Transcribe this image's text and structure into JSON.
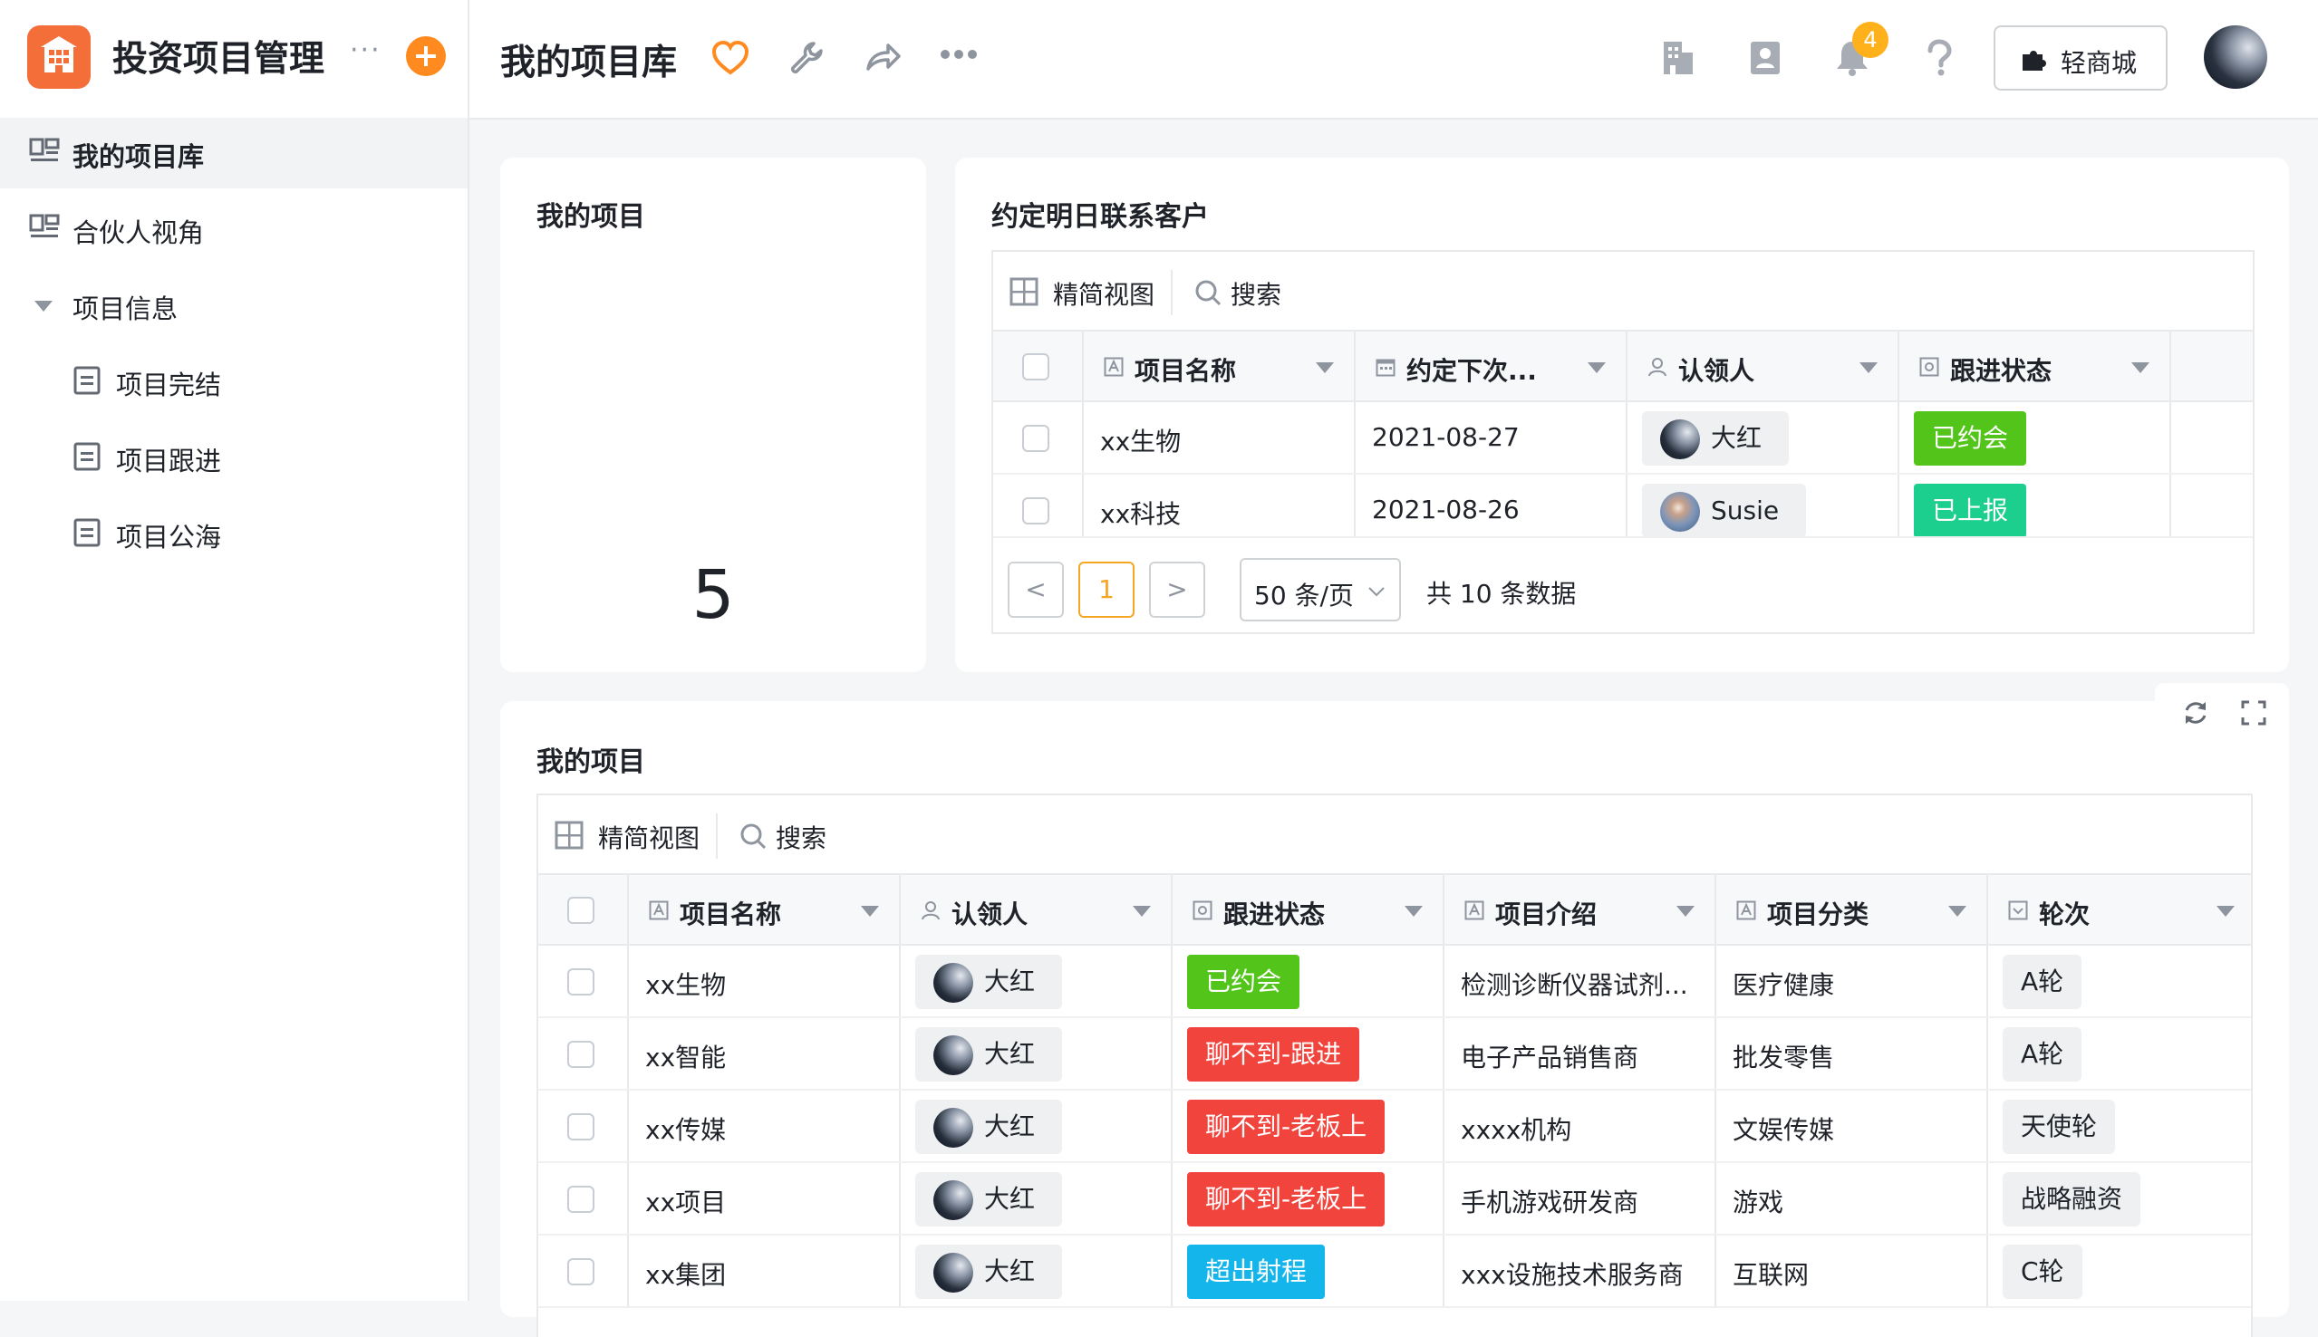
{
  "app": {
    "title": "投资项目管理",
    "more": "···"
  },
  "sidebar": {
    "items": [
      {
        "label": "我的项目库"
      },
      {
        "label": "合伙人视角"
      },
      {
        "label": "项目信息"
      },
      {
        "label": "项目完结"
      },
      {
        "label": "项目跟进"
      },
      {
        "label": "项目公海"
      }
    ]
  },
  "topbar": {
    "page_title": "我的项目库",
    "notification_count": "4",
    "store_label": "轻商城"
  },
  "summary_card": {
    "title": "我的项目",
    "value": "5"
  },
  "contact_card": {
    "title": "约定明日联系客户",
    "view_label": "精简视图",
    "search_label": "搜索",
    "columns": [
      "项目名称",
      "约定下次...",
      "认领人",
      "跟进状态"
    ],
    "rows": [
      {
        "name": "xx生物",
        "date": "2021-08-27",
        "owner": "大红",
        "status": "已约会"
      },
      {
        "name": "xx科技",
        "date": "2021-08-26",
        "owner": "Susie",
        "status": "已上报"
      }
    ],
    "pagination": {
      "prev": "<",
      "page": "1",
      "next": ">",
      "page_size": "50 条/页",
      "total": "共 10 条数据"
    }
  },
  "projects_card": {
    "title": "我的项目",
    "view_label": "精简视图",
    "search_label": "搜索",
    "columns": [
      "项目名称",
      "认领人",
      "跟进状态",
      "项目介绍",
      "项目分类",
      "轮次"
    ],
    "rows": [
      {
        "name": "xx生物",
        "owner": "大红",
        "status": "已约会",
        "intro": "检测诊断仪器试剂...",
        "category": "医疗健康",
        "round": "A轮"
      },
      {
        "name": "xx智能",
        "owner": "大红",
        "status": "聊不到-跟进",
        "intro": "电子产品销售商",
        "category": "批发零售",
        "round": "A轮"
      },
      {
        "name": "xx传媒",
        "owner": "大红",
        "status": "聊不到-老板上",
        "intro": "xxxx机构",
        "category": "文娱传媒",
        "round": "天使轮"
      },
      {
        "name": "xx项目",
        "owner": "大红",
        "status": "聊不到-老板上",
        "intro": "手机游戏研发商",
        "category": "游戏",
        "round": "战略融资"
      },
      {
        "name": "xx集团",
        "owner": "大红",
        "status": "超出射程",
        "intro": "xxx设施技术服务商",
        "category": "互联网",
        "round": "C轮"
      }
    ]
  },
  "colors": {
    "brand": "#f46e3a",
    "status_met": "#52c41a",
    "status_reported": "#1ccf8e",
    "status_unreachable": "#f0443c",
    "status_out_of_range": "#13b5ea",
    "accent_orange": "#ff8a1f"
  }
}
